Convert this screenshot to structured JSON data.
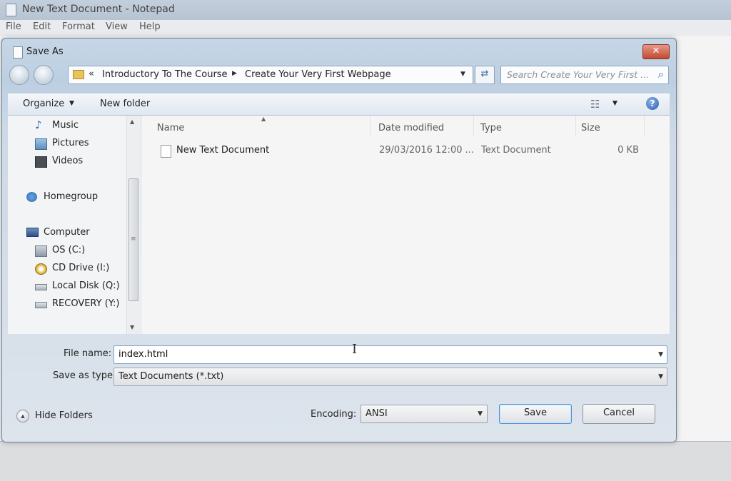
{
  "notepad": {
    "title": "New Text Document - Notepad",
    "menu": [
      "File",
      "Edit",
      "Format",
      "View",
      "Help"
    ]
  },
  "dialog": {
    "title": "Save As",
    "close_label": "✕",
    "address": {
      "overflow": "«",
      "crumbs": [
        "Introductory To The Course",
        "Create Your Very First Webpage"
      ]
    },
    "search_placeholder": "Search Create Your Very First ...",
    "toolbar": {
      "organize": "Organize",
      "new_folder": "New folder",
      "help": "?"
    },
    "nav_pane": {
      "items": [
        {
          "label": "Music",
          "icon": "music-icon"
        },
        {
          "label": "Pictures",
          "icon": "pictures-icon"
        },
        {
          "label": "Videos",
          "icon": "videos-icon"
        },
        {
          "label": "Homegroup",
          "icon": "homegroup-icon"
        },
        {
          "label": "Computer",
          "icon": "computer-icon"
        },
        {
          "label": "OS (C:)",
          "icon": "drive-icon"
        },
        {
          "label": "CD Drive (I:)",
          "icon": "cd-drive-icon"
        },
        {
          "label": "Local Disk (Q:)",
          "icon": "drive-icon"
        },
        {
          "label": "RECOVERY (Y:)",
          "icon": "drive-icon"
        }
      ]
    },
    "file_list": {
      "columns": [
        "Name",
        "Date modified",
        "Type",
        "Size"
      ],
      "rows": [
        {
          "name": "New Text Document",
          "date": "29/03/2016 12:00 ...",
          "type": "Text Document",
          "size": "0 KB"
        }
      ]
    },
    "file_name": {
      "label": "File name:",
      "value": "index.html"
    },
    "save_as_type": {
      "label": "Save as type:",
      "value": "Text Documents (*.txt)"
    },
    "hide_folders": "Hide Folders",
    "encoding": {
      "label": "Encoding:",
      "value": "ANSI"
    },
    "buttons": {
      "save": "Save",
      "cancel": "Cancel"
    }
  }
}
